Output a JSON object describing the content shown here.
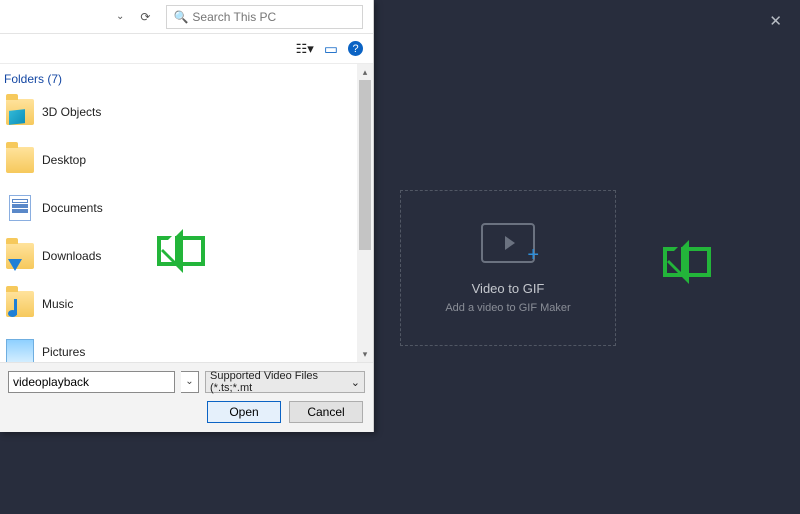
{
  "app": {
    "dropzone_title": "Video to GIF",
    "dropzone_sub": "Add a video to GIF Maker"
  },
  "dialog": {
    "search_placeholder": "Search This PC",
    "group_header": "Folders (7)",
    "filename_value": "videoplayback",
    "filter_value": "Supported Video Files (*.ts;*.mt",
    "open_label": "Open",
    "cancel_label": "Cancel",
    "items": [
      {
        "label": "3D Objects",
        "icon": "folder-3d"
      },
      {
        "label": "Desktop",
        "icon": "folder"
      },
      {
        "label": "Documents",
        "icon": "doc"
      },
      {
        "label": "Downloads",
        "icon": "folder-dl"
      },
      {
        "label": "Music",
        "icon": "folder-music"
      },
      {
        "label": "Pictures",
        "icon": "folder-pic"
      }
    ]
  }
}
